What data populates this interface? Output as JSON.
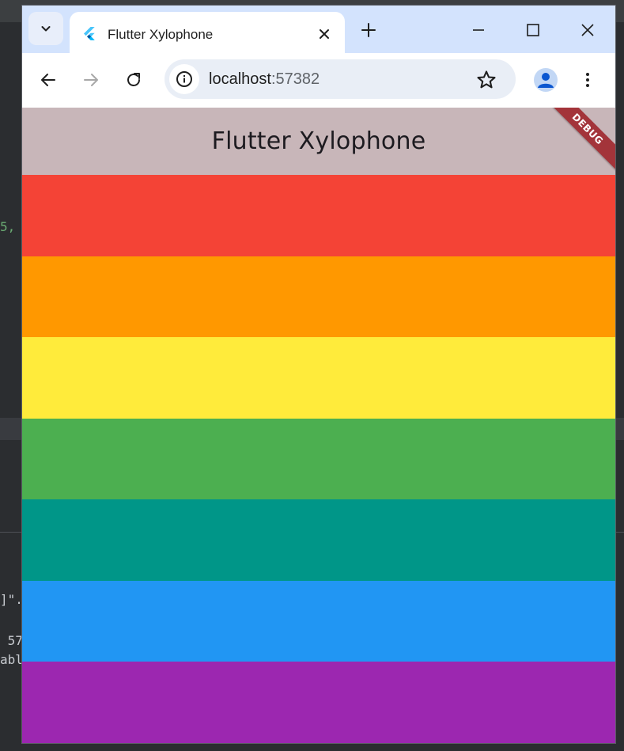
{
  "browser": {
    "tab": {
      "title": "Flutter Xylophone",
      "favicon": "flutter-logo-icon"
    },
    "address_bar": {
      "host": "localhost",
      "port": ":57382"
    },
    "icons": {
      "tab_search": "chevron-down-icon",
      "close_tab": "close-icon",
      "new_tab": "plus-icon",
      "minimize": "minimize-icon",
      "maximize": "maximize-icon",
      "close_window": "close-icon",
      "back": "back-arrow-icon",
      "forward": "forward-arrow-icon",
      "reload": "reload-icon",
      "site_info": "info-icon",
      "bookmark": "star-icon",
      "profile": "person-icon",
      "menu": "more-vert-icon"
    }
  },
  "app": {
    "title": "Flutter Xylophone",
    "debug_banner": "DEBUG",
    "appbar_color": "#c8b6b9",
    "keys": [
      {
        "name": "red",
        "color": "#f44336"
      },
      {
        "name": "orange",
        "color": "#ff9800"
      },
      {
        "name": "yellow",
        "color": "#ffeb3b"
      },
      {
        "name": "green",
        "color": "#4caf50"
      },
      {
        "name": "teal",
        "color": "#009688"
      },
      {
        "name": "blue",
        "color": "#2196f3"
      },
      {
        "name": "purple",
        "color": "#9c27b0"
      }
    ]
  },
  "background_fragments": {
    "frag1": "5,",
    "frag2": "]\".",
    "frag3": " 57",
    "frag4": "abl"
  }
}
